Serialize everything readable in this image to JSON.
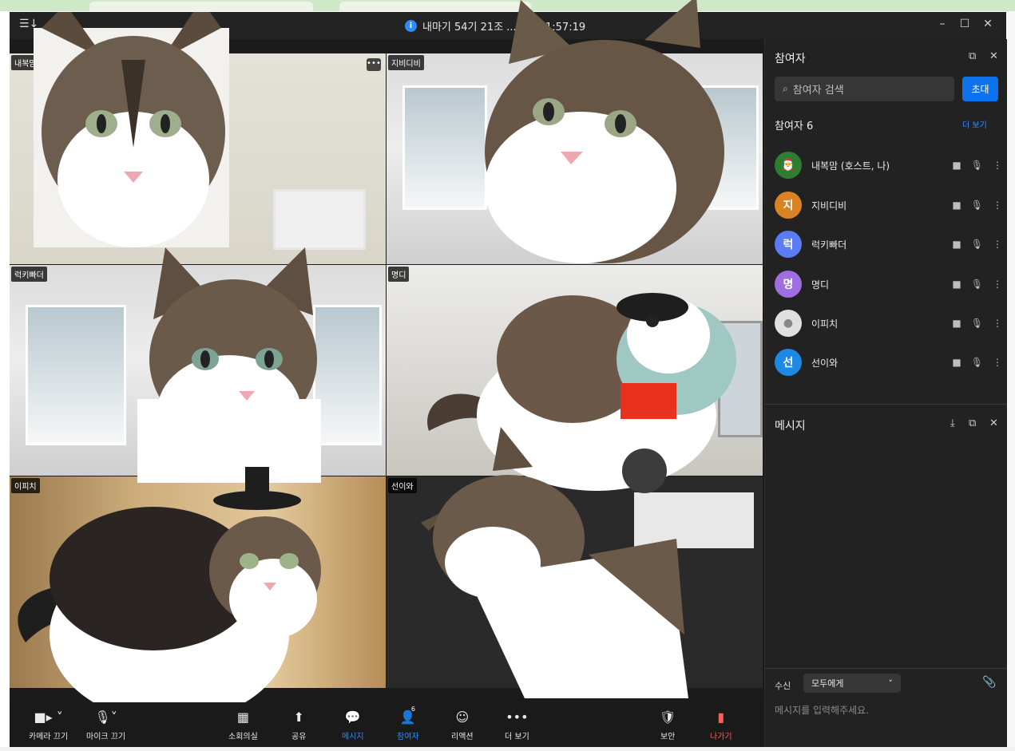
{
  "window": {
    "meeting_title": "내마기 54기 21조 ...모임 01:57:19",
    "minimize": "–",
    "maximize": "☐",
    "close": "✕"
  },
  "tiles": [
    {
      "name": "내복맘"
    },
    {
      "name": "지비디비"
    },
    {
      "name": "럭키빠더"
    },
    {
      "name": "명디"
    },
    {
      "name": "이피치"
    },
    {
      "name": "선이와"
    }
  ],
  "toolbar": {
    "camera": "카메라 끄기",
    "mic": "마이크 끄기",
    "breakout": "소회의실",
    "share": "공유",
    "chat": "메시지",
    "participants": "참여자",
    "participants_count": "6",
    "reactions": "리액션",
    "more": "더 보기",
    "security": "보안",
    "leave": "나가기"
  },
  "panel": {
    "title": "참여자",
    "search_placeholder": "참여자 검색",
    "invite": "초대",
    "count_label": "참여자 6",
    "more_link": "더 보기",
    "participants": [
      {
        "name": "내복맘  (호스트, 나)",
        "initial": "",
        "color": "#2e7d32"
      },
      {
        "name": "지비디비",
        "initial": "지",
        "color": "#d98324"
      },
      {
        "name": "럭키빠더",
        "initial": "럭",
        "color": "#5c7cf6"
      },
      {
        "name": "명디",
        "initial": "명",
        "color": "#a06ee0"
      },
      {
        "name": "이피치",
        "initial": "",
        "color": "#e0e0e0"
      },
      {
        "name": "선이와",
        "initial": "선",
        "color": "#1e88e5"
      }
    ],
    "chat_title": "메시지",
    "recipient_label": "수신",
    "recipient_value": "모두에게",
    "message_placeholder": "메시지를 입력해주세요."
  }
}
